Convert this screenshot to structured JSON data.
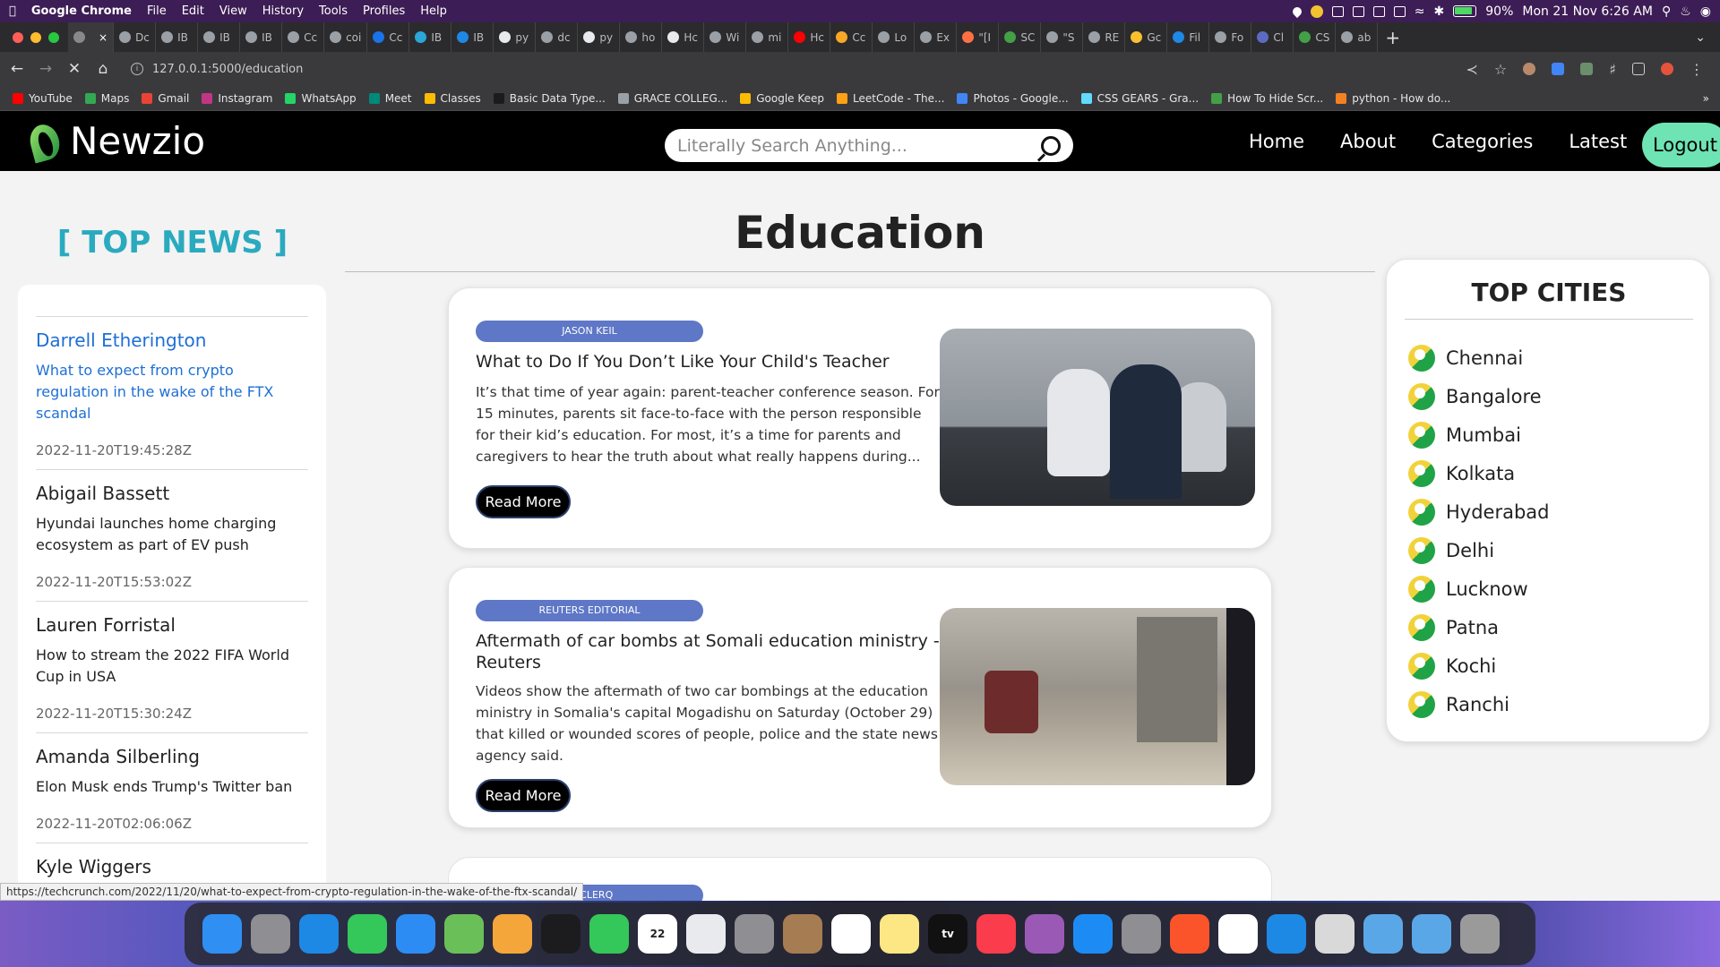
{
  "menubar": {
    "app": "Google Chrome",
    "items": [
      "File",
      "Edit",
      "View",
      "History",
      "Tools",
      "Profiles",
      "Help"
    ],
    "battery": "90%",
    "datetime": "Mon 21 Nov  6:26 AM"
  },
  "tabs": [
    {
      "label": "",
      "color": "#888888",
      "active": true
    },
    {
      "label": "Dc",
      "color": "#9aa0a6"
    },
    {
      "label": "IB",
      "color": "#9aa0a6"
    },
    {
      "label": "IB",
      "color": "#9aa0a6"
    },
    {
      "label": "IB",
      "color": "#9aa0a6"
    },
    {
      "label": "Cc",
      "color": "#9aa0a6"
    },
    {
      "label": "coi",
      "color": "#9aa0a6"
    },
    {
      "label": "Cc",
      "color": "#1a73e8"
    },
    {
      "label": "IB",
      "color": "#2aa6d8"
    },
    {
      "label": "IB",
      "color": "#1e88e5"
    },
    {
      "label": "py",
      "color": "#e8eaed"
    },
    {
      "label": "dc",
      "color": "#9aa0a6"
    },
    {
      "label": "py",
      "color": "#e8eaed"
    },
    {
      "label": "ho",
      "color": "#9aa0a6"
    },
    {
      "label": "Hc",
      "color": "#e8eaed"
    },
    {
      "label": "Wi",
      "color": "#9aa0a6"
    },
    {
      "label": "mi",
      "color": "#9aa0a6"
    },
    {
      "label": "Hc",
      "color": "#ff0000"
    },
    {
      "label": "Cc",
      "color": "#f9a825"
    },
    {
      "label": "Lo",
      "color": "#9aa0a6"
    },
    {
      "label": "Ex",
      "color": "#9aa0a6"
    },
    {
      "label": "\"[I",
      "color": "#ff7043"
    },
    {
      "label": "SC",
      "color": "#43a047"
    },
    {
      "label": "\"S",
      "color": "#9aa0a6"
    },
    {
      "label": "RE",
      "color": "#9aa0a6"
    },
    {
      "label": "Gc",
      "color": "#fbc02d"
    },
    {
      "label": "Fil",
      "color": "#1e88e5"
    },
    {
      "label": "Fo",
      "color": "#9aa0a6"
    },
    {
      "label": "Cl",
      "color": "#5c6bc0"
    },
    {
      "label": "CS",
      "color": "#43a047"
    },
    {
      "label": "ab",
      "color": "#9aa0a6"
    }
  ],
  "toolbar": {
    "url": "127.0.0.1:5000/education"
  },
  "bookmarks": [
    {
      "label": "YouTube",
      "color": "#ff0000"
    },
    {
      "label": "Maps",
      "color": "#34a853"
    },
    {
      "label": "Gmail",
      "color": "#ea4335"
    },
    {
      "label": "Instagram",
      "color": "#c13584"
    },
    {
      "label": "WhatsApp",
      "color": "#25d366"
    },
    {
      "label": "Meet",
      "color": "#00897b"
    },
    {
      "label": "Classes",
      "color": "#fbbc04"
    },
    {
      "label": "Basic Data Type...",
      "color": "#1b1b1b"
    },
    {
      "label": "GRACE COLLEG...",
      "color": "#9aa0a6"
    },
    {
      "label": "Google Keep",
      "color": "#fbbc04"
    },
    {
      "label": "LeetCode - The...",
      "color": "#ffa116"
    },
    {
      "label": "Photos - Google...",
      "color": "#4285f4"
    },
    {
      "label": "CSS GEARS - Gra...",
      "color": "#61dafb"
    },
    {
      "label": "How To Hide Scr...",
      "color": "#43a047"
    },
    {
      "label": "python - How do...",
      "color": "#f48024"
    }
  ],
  "site": {
    "brand": "Newzio",
    "search_placeholder": "Literally Search Anything...",
    "nav": [
      "Home",
      "About",
      "Categories",
      "Latest"
    ],
    "logout": "Logout"
  },
  "top_news": {
    "title": "[ TOP NEWS ]",
    "items": [
      {
        "author": "Darrell Etherington",
        "text": "What to expect from crypto regulation in the wake of the FTX scandal",
        "date": "2022-11-20T19:45:28Z",
        "highlighted": true
      },
      {
        "author": "Abigail Bassett",
        "text": "Hyundai launches home charging ecosystem as part of EV push",
        "date": "2022-11-20T15:53:02Z"
      },
      {
        "author": "Lauren Forristal",
        "text": "How to stream the 2022 FIFA World Cup in USA",
        "date": "2022-11-20T15:30:24Z"
      },
      {
        "author": "Amanda Silberling",
        "text": "Elon Musk ends Trump's Twitter ban",
        "date": "2022-11-20T02:06:06Z"
      },
      {
        "author": "Kyle Wiggers",
        "text": "",
        "date": ""
      }
    ]
  },
  "main": {
    "title": "Education",
    "cards": [
      {
        "badge": "JASON KEIL",
        "title": "What to Do If You Don’t Like Your Child's Teacher",
        "description": "It’s that time of year again: parent-teacher conference season. For 15 minutes, parents sit face-to-face with the person responsible for their kid’s education. For most, it’s a time for parents and caregivers to hear the truth about what really happens during...",
        "button": "Read More"
      },
      {
        "badge": "REUTERS EDITORIAL",
        "title": "Aftermath of car bombs at Somali education ministry - Reuters",
        "description": "Videos show the aftermath of two car bombings at the education ministry in Somalia's capital Mogadishu on Saturday (October 29) that killed or wounded scores of people, police and the state news agency said.",
        "button": "Read More"
      },
      {
        "badge": "DECLERQ",
        "title": "",
        "description": "",
        "button": ""
      }
    ]
  },
  "top_cities": {
    "title": "TOP CITIES",
    "cities": [
      "Chennai",
      "Bangalore",
      "Mumbai",
      "Kolkata",
      "Hyderabad",
      "Delhi",
      "Lucknow",
      "Patna",
      "Kochi",
      "Ranchi"
    ]
  },
  "status_url": "https://techcrunch.com/2022/11/20/what-to-expect-from-crypto-regulation-in-the-wake-of-the-ftx-scandal/",
  "dock": [
    {
      "name": "finder",
      "color": "#2f8ff3"
    },
    {
      "name": "launchpad",
      "color": "#8e8e93"
    },
    {
      "name": "safari",
      "color": "#1e88e5"
    },
    {
      "name": "messages",
      "color": "#34c759"
    },
    {
      "name": "mail",
      "color": "#2c8cf4"
    },
    {
      "name": "maps",
      "color": "#6bbf59"
    },
    {
      "name": "photos",
      "color": "#f4a63a"
    },
    {
      "name": "voice-memos",
      "color": "#1c1c1e"
    },
    {
      "name": "facetime",
      "color": "#34c759"
    },
    {
      "name": "calendar",
      "color": "#ffffff",
      "label": "22"
    },
    {
      "name": "chrome",
      "color": "#e8eaed"
    },
    {
      "name": "disk-utility",
      "color": "#8e8e93"
    },
    {
      "name": "contacts",
      "color": "#a67c52"
    },
    {
      "name": "reminders",
      "color": "#ffffff"
    },
    {
      "name": "notes",
      "color": "#fce784"
    },
    {
      "name": "apple-tv",
      "color": "#111111",
      "label": "tv"
    },
    {
      "name": "music",
      "color": "#fa3c4c"
    },
    {
      "name": "podcasts",
      "color": "#9b59b6"
    },
    {
      "name": "app-store",
      "color": "#1c8cf4"
    },
    {
      "name": "system-preferences",
      "color": "#8e8e93"
    },
    {
      "name": "brave",
      "color": "#fb542b"
    },
    {
      "name": "anaconda",
      "color": "#ffffff"
    },
    {
      "name": "vscode",
      "color": "#1e88e5"
    },
    {
      "name": "screenshot",
      "color": "#d9d9d9"
    },
    {
      "name": "downloads-folder",
      "color": "#5aa7e8"
    },
    {
      "name": "documents-folder",
      "color": "#5aa7e8"
    },
    {
      "name": "trash",
      "color": "#9a9a9a"
    }
  ]
}
